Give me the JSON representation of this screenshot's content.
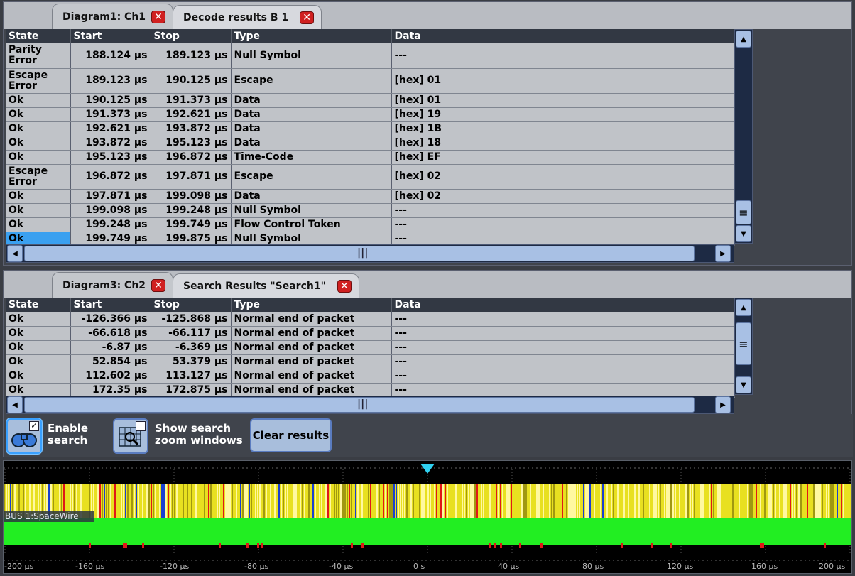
{
  "top_panel": {
    "tabs": [
      {
        "label": "Diagram1: Ch1",
        "close": "✕"
      },
      {
        "label": "Decode results B 1",
        "close": "✕"
      }
    ],
    "columns": [
      "State",
      "Start",
      "Stop",
      "Type",
      "Data"
    ],
    "rows": [
      {
        "state": "Parity Error",
        "start": "188.124 µs",
        "stop": "189.123 µs",
        "type": "Null Symbol",
        "data": "---"
      },
      {
        "state": "Escape Error",
        "start": "189.123 µs",
        "stop": "190.125 µs",
        "type": "Escape",
        "data": "[hex] 01"
      },
      {
        "state": "Ok",
        "start": "190.125 µs",
        "stop": "191.373 µs",
        "type": "Data",
        "data": "[hex] 01"
      },
      {
        "state": "Ok",
        "start": "191.373 µs",
        "stop": "192.621 µs",
        "type": "Data",
        "data": "[hex] 19"
      },
      {
        "state": "Ok",
        "start": "192.621 µs",
        "stop": "193.872 µs",
        "type": "Data",
        "data": "[hex] 1B"
      },
      {
        "state": "Ok",
        "start": "193.872 µs",
        "stop": "195.123 µs",
        "type": "Data",
        "data": "[hex] 18"
      },
      {
        "state": "Ok",
        "start": "195.123 µs",
        "stop": "196.872 µs",
        "type": "Time-Code",
        "data": "[hex] EF"
      },
      {
        "state": "Escape Error",
        "start": "196.872 µs",
        "stop": "197.871 µs",
        "type": "Escape",
        "data": "[hex] 02"
      },
      {
        "state": "Ok",
        "start": "197.871 µs",
        "stop": "199.098 µs",
        "type": "Data",
        "data": "[hex] 02"
      },
      {
        "state": "Ok",
        "start": "199.098 µs",
        "stop": "199.248 µs",
        "type": "Null Symbol",
        "data": "---"
      },
      {
        "state": "Ok",
        "start": "199.248 µs",
        "stop": "199.749 µs",
        "type": "Flow Control Token",
        "data": "---"
      },
      {
        "state": "Ok",
        "start": "199.749 µs",
        "stop": "199.875 µs",
        "type": "Null Symbol",
        "data": "---"
      }
    ]
  },
  "mid_panel": {
    "tabs": [
      {
        "label": "Diagram3: Ch2",
        "close": "✕"
      },
      {
        "label": "Search Results \"Search1\"",
        "close": "✕"
      }
    ],
    "columns": [
      "State",
      "Start",
      "Stop",
      "Type",
      "Data"
    ],
    "rows": [
      {
        "state": "Ok",
        "start": "-126.366 µs",
        "stop": "-125.868 µs",
        "type": "Normal end of packet",
        "data": "---"
      },
      {
        "state": "Ok",
        "start": "-66.618 µs",
        "stop": "-66.117 µs",
        "type": "Normal end of packet",
        "data": "---"
      },
      {
        "state": "Ok",
        "start": "-6.87 µs",
        "stop": "-6.369 µs",
        "type": "Normal end of packet",
        "data": "---"
      },
      {
        "state": "Ok",
        "start": "52.854 µs",
        "stop": "53.379 µs",
        "type": "Normal end of packet",
        "data": "---"
      },
      {
        "state": "Ok",
        "start": "112.602 µs",
        "stop": "113.127 µs",
        "type": "Normal end of packet",
        "data": "---"
      },
      {
        "state": "Ok",
        "start": "172.35 µs",
        "stop": "172.875 µs",
        "type": "Normal end of packet",
        "data": "---"
      }
    ],
    "buttons": {
      "enable_search": "Enable\nsearch",
      "show_zoom": "Show search\nzoom windows",
      "clear": "Clear results"
    }
  },
  "waveform": {
    "bus_label": "BUS 1:SpaceWire",
    "time_labels": [
      "-200 µs",
      "-160 µs",
      "-120 µs",
      "-80 µs",
      "-40 µs",
      "0 s",
      "40 µs",
      "80 µs",
      "120 µs",
      "160 µs",
      "200 µs"
    ],
    "colors": {
      "data": "#e8e020",
      "idle": "#22ee22",
      "error": "#e01818",
      "control": "#1a40d0",
      "trigger": "#30d0f0"
    }
  },
  "scroll": {
    "up": "▲",
    "down": "▼",
    "left": "◀",
    "right": "▶",
    "grip_v": "≡",
    "grip_h": "|||"
  }
}
